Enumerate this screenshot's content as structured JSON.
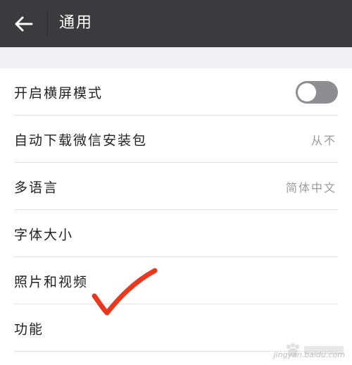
{
  "header": {
    "title": "通用",
    "back_icon": "arrow-left-icon",
    "background_color": "#3b3b3d"
  },
  "settings": [
    {
      "label": "开启横屏模式",
      "control": "toggle",
      "toggle_on": false
    },
    {
      "label": "自动下载微信安装包",
      "value": "从不"
    },
    {
      "label": "多语言",
      "value": "简体中文"
    },
    {
      "label": "字体大小"
    },
    {
      "label": "照片和视频"
    },
    {
      "label": "功能"
    }
  ],
  "annotation": {
    "mark": "checkmark",
    "color": "#e8391e"
  },
  "watermark": {
    "text": "jingyan.baidu.com"
  }
}
